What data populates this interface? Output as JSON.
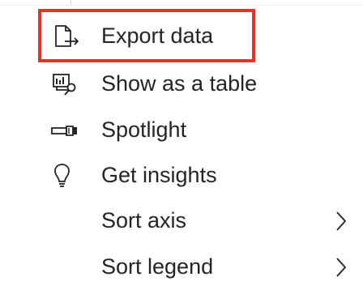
{
  "menu": {
    "items": [
      {
        "label": "Export data",
        "icon": "export-data-icon",
        "has_submenu": false
      },
      {
        "label": "Show as a table",
        "icon": "show-as-table-icon",
        "has_submenu": false
      },
      {
        "label": "Spotlight",
        "icon": "spotlight-icon",
        "has_submenu": false
      },
      {
        "label": "Get insights",
        "icon": "lightbulb-icon",
        "has_submenu": false
      },
      {
        "label": "Sort axis",
        "icon": "chevron-right-icon",
        "has_submenu": true
      },
      {
        "label": "Sort legend",
        "icon": "chevron-right-icon",
        "has_submenu": true
      }
    ]
  },
  "highlight": {
    "target": "Export data",
    "color": "#e5332a"
  },
  "colors": {
    "text": "#252423",
    "background": "#ffffff"
  }
}
